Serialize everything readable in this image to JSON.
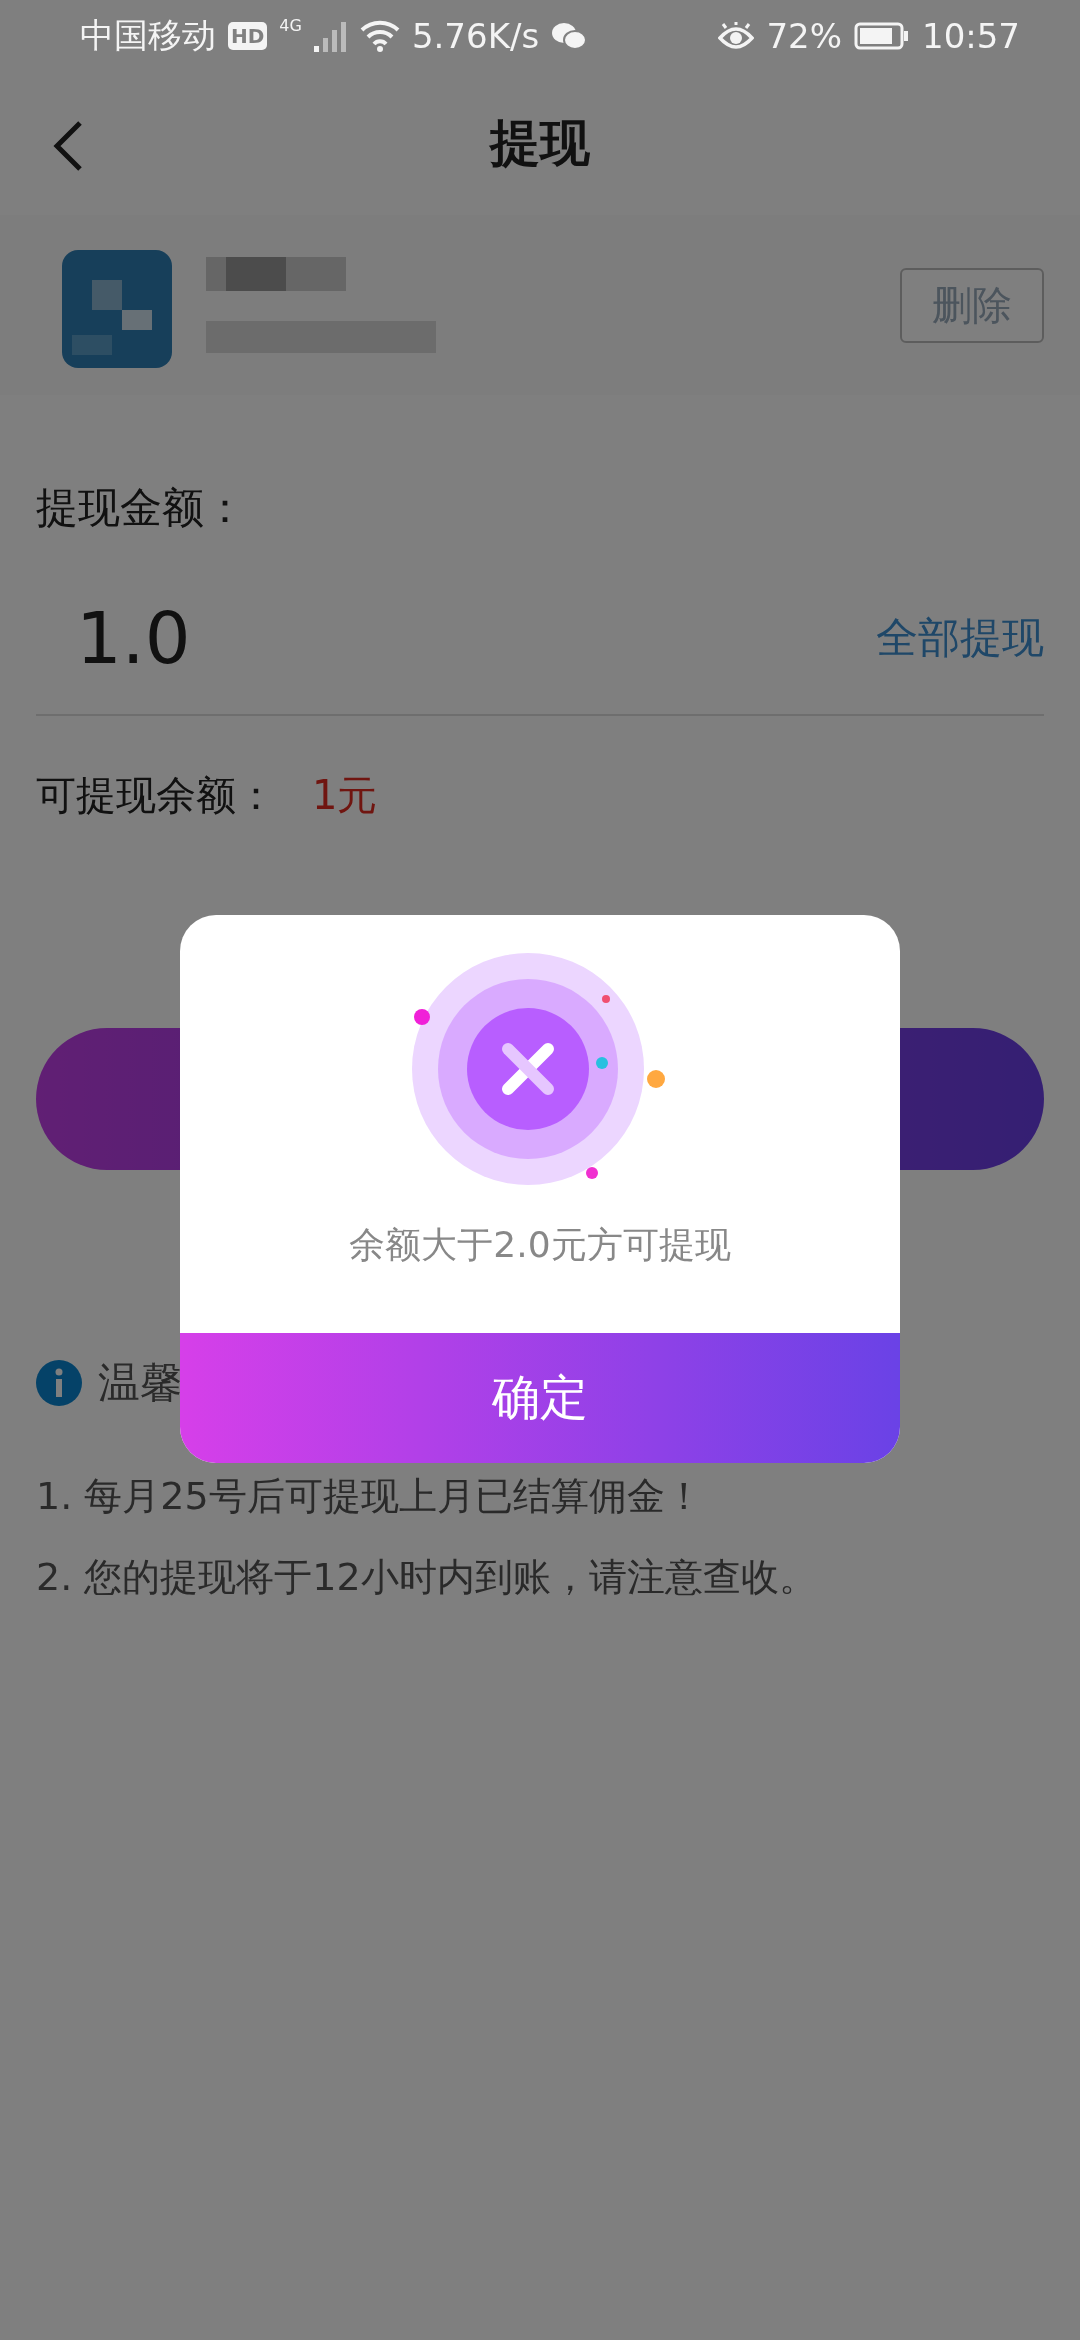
{
  "status_bar": {
    "carrier": "中国移动",
    "hd": "HD",
    "network": "4G",
    "speed": "5.76K/s",
    "battery": "72%",
    "time": "10:57"
  },
  "header": {
    "title": "提现"
  },
  "account": {
    "delete_label": "删除"
  },
  "amount": {
    "label": "提现金额：",
    "value": "1.0",
    "withdraw_all": "全部提现"
  },
  "balance": {
    "label": "可提现余额：",
    "value": "1元"
  },
  "tips": {
    "title": "温馨",
    "items": [
      "1. 每月25号后可提现上月已结算佣金！",
      "2. 您的提现将于12小时内到账，请注意查收。"
    ]
  },
  "dialog": {
    "message": "余额大于2.0元方可提现",
    "confirm": "确定"
  }
}
